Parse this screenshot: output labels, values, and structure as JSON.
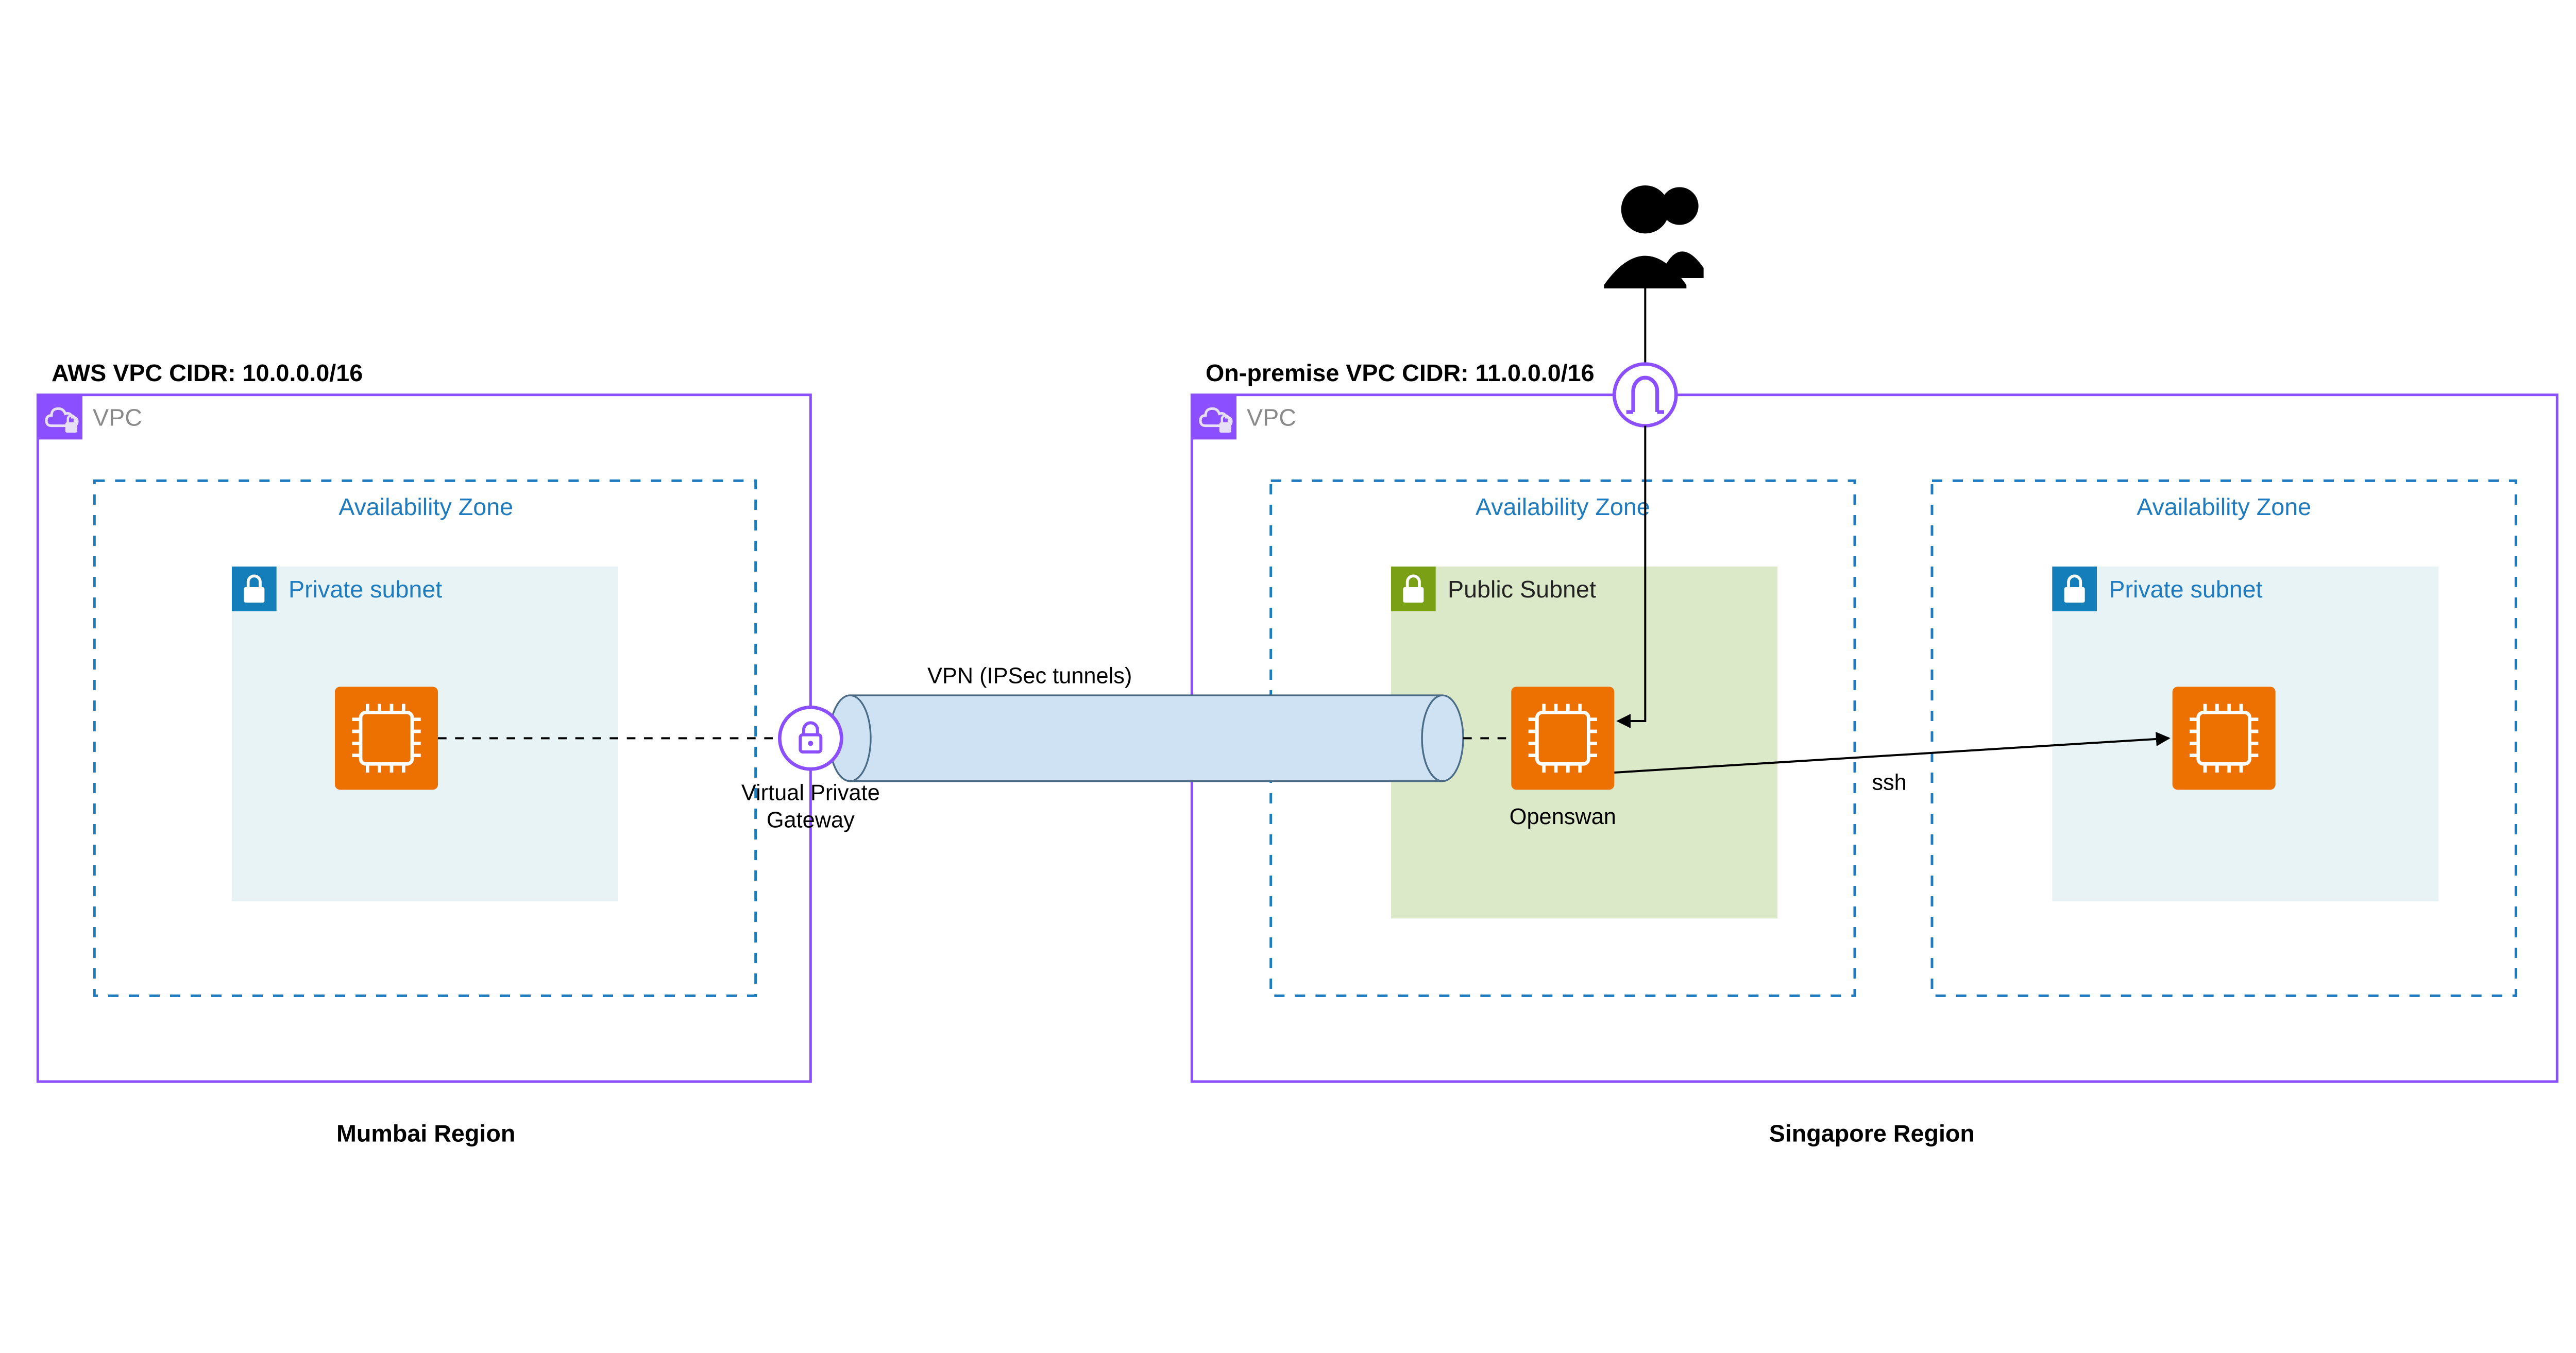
{
  "vpc_left": {
    "title": "AWS VPC CIDR: 10.0.0.0/16",
    "label": "VPC",
    "az_label": "Availability Zone",
    "subnet_label": "Private subnet",
    "region": "Mumbai Region"
  },
  "vpc_right": {
    "title": "On-premise VPC CIDR: 11.0.0.0/16",
    "label": "VPC",
    "az1_label": "Availability Zone",
    "az2_label": "Availability Zone",
    "subnet_pub_label": "Public Subnet",
    "subnet_priv_label": "Private subnet",
    "region": "Singapore Region"
  },
  "gateway": {
    "vpg_line1": "Virtual Private",
    "vpg_line2": "Gateway"
  },
  "tunnel_label": "VPN (IPSec tunnels)",
  "openswan_label": "Openswan",
  "ssh_label": "ssh"
}
